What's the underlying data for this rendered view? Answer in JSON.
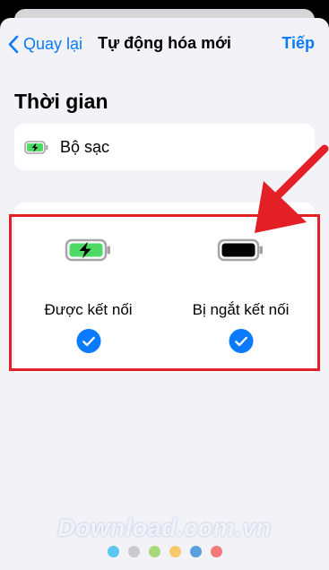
{
  "navbar": {
    "back_label": "Quay lại",
    "title": "Tự động hóa mới",
    "next_label": "Tiếp"
  },
  "section": {
    "title": "Thời gian"
  },
  "trigger": {
    "label": "Bộ sạc",
    "icon": "battery-charging-icon"
  },
  "options": [
    {
      "label": "Được kết nối",
      "icon": "battery-charging-icon",
      "checked": true
    },
    {
      "label": "Bị ngắt kết nối",
      "icon": "battery-full-icon",
      "checked": true
    }
  ],
  "watermark": {
    "text": "Download.com.vn"
  },
  "colors": {
    "accent": "#0a7aff",
    "highlight": "#e32026",
    "battery_green": "#4cd964",
    "dots": [
      "#5bc7f0",
      "#c9c9cf",
      "#a7d97a",
      "#f7c96b",
      "#5aa0e0",
      "#f07979"
    ]
  }
}
